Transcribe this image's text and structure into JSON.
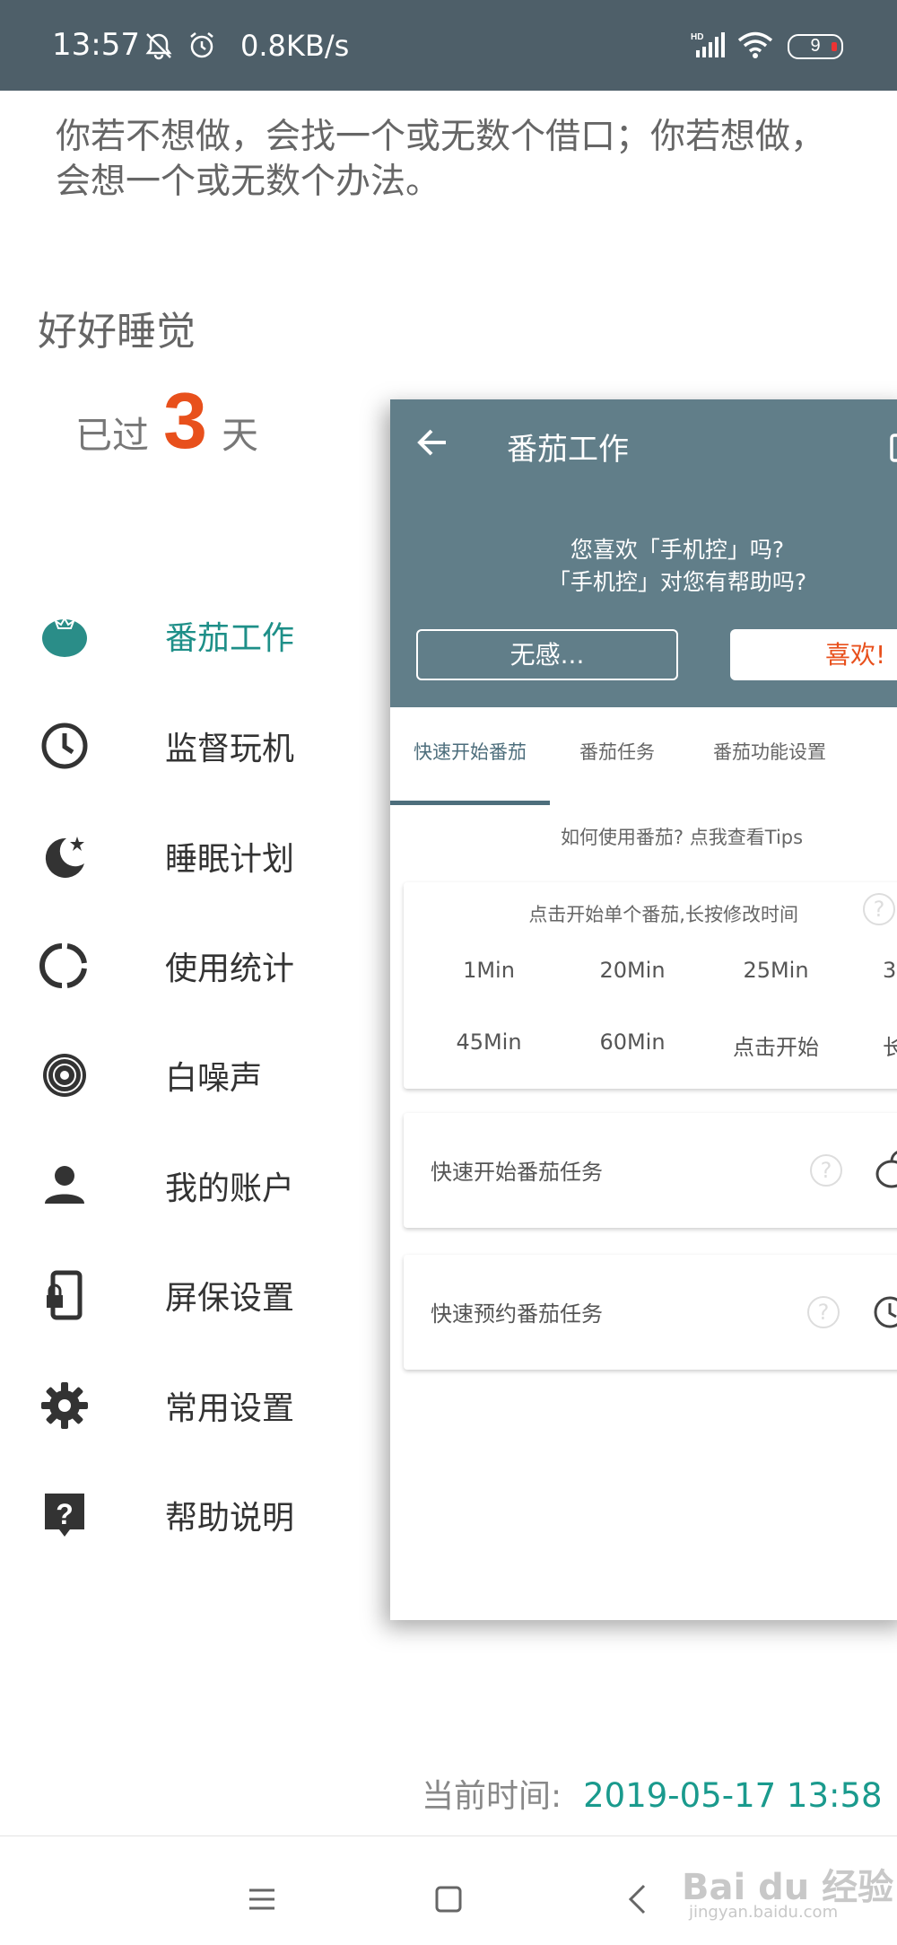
{
  "status_bar": {
    "time": "13:57",
    "speed": "0.8KB/s",
    "battery": "9",
    "icons": [
      "mute-icon",
      "alarm-icon",
      "hd-signal-icon",
      "wifi-icon",
      "battery-icon"
    ]
  },
  "quote": "你若不想做，会找一个或无数个借口；你若想做，会想一个或无数个办法。",
  "goal": {
    "title": "好好睡觉",
    "prefix": "已过",
    "days": "3",
    "suffix": "天"
  },
  "menu": [
    {
      "label": "番茄工作",
      "icon": "tomato-icon",
      "active": true
    },
    {
      "label": "监督玩机",
      "icon": "clock-icon"
    },
    {
      "label": "睡眠计划",
      "icon": "moon-star-icon"
    },
    {
      "label": "使用统计",
      "icon": "pie-ring-icon"
    },
    {
      "label": "白噪声",
      "icon": "disc-icon"
    },
    {
      "label": "我的账户",
      "icon": "person-icon"
    },
    {
      "label": "屏保设置",
      "icon": "phone-lock-icon"
    },
    {
      "label": "常用设置",
      "icon": "gear-icon"
    },
    {
      "label": "帮助说明",
      "icon": "help-icon"
    }
  ],
  "current_time": {
    "label": "当前时间:",
    "value": "2019-05-17  13:58"
  },
  "watermark": {
    "brand": "Bai du 经验",
    "site": "jingyan.baidu.com"
  },
  "card": {
    "title": "番茄工作",
    "banner_q1": "您喜欢「手机控」吗?",
    "banner_q2": "「手机控」对您有帮助吗?",
    "btn_meh": "无感...",
    "btn_like": "喜欢!",
    "tabs": [
      "快速开始番茄",
      "番茄任务",
      "番茄功能设置"
    ],
    "tips": "如何使用番茄? 点我查看Tips",
    "quick_hint": "点击开始单个番茄,长按修改时间",
    "durations_row1": [
      "1Min",
      "20Min",
      "25Min",
      "3"
    ],
    "durations_row2": [
      "45Min",
      "60Min",
      "点击开始",
      "长"
    ],
    "quick_task": "快速开始番茄任务",
    "schedule_task": "快速预约番茄任务",
    "colors": {
      "toolbar": "#617e89",
      "accent": "#e8501c",
      "teal": "#1e8f88"
    }
  }
}
